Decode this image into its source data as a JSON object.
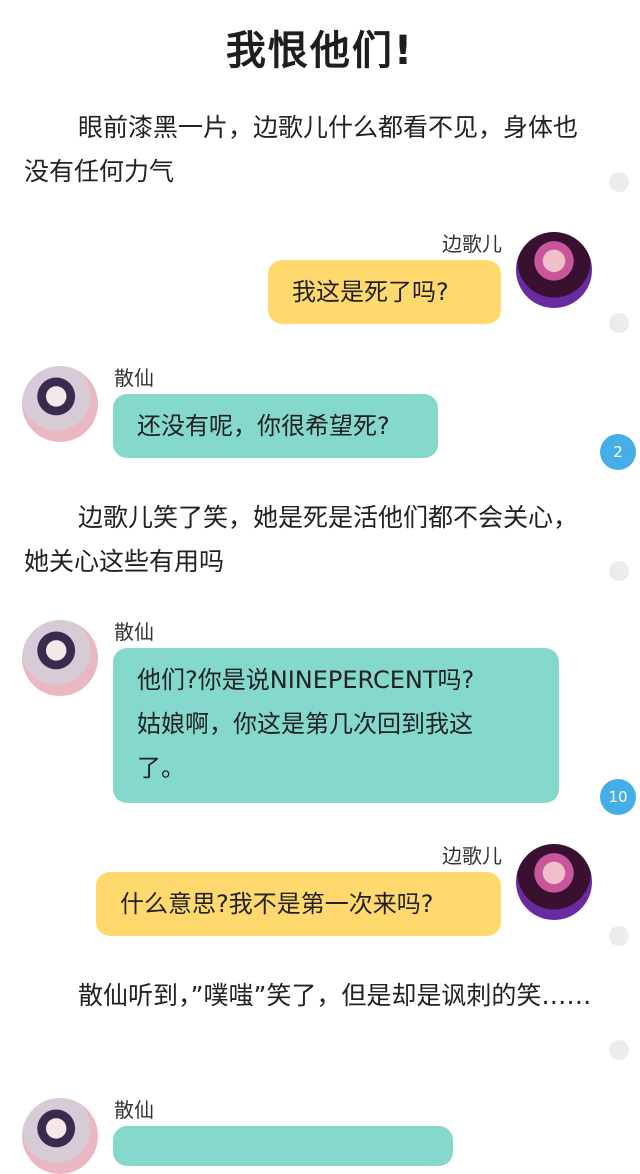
{
  "title": "我恨他们!",
  "blocks": {
    "n1": "眼前漆黑一片，边歌儿什么都看不见，身体也没有任何力气",
    "m1": {
      "speaker": "边歌儿",
      "text": "我这是死了吗?"
    },
    "m2": {
      "speaker": "散仙",
      "text": "还没有呢，你很希望死?",
      "badge": "2"
    },
    "n2": "边歌儿笑了笑，她是死是活他们都不会关心，她关心这些有用吗",
    "m3": {
      "speaker": "散仙",
      "text_lines": [
        "他们?你是说NINEPERCENT吗?",
        "姑娘啊，你这是第几次回到我这",
        "了。"
      ],
      "badge": "10"
    },
    "m4": {
      "speaker": "边歌儿",
      "text": "什么意思?我不是第一次来吗?"
    },
    "n3": "散仙听到，”噗嗤”笑了，但是却是讽刺的笑……",
    "m5": {
      "speaker": "散仙"
    }
  },
  "colors": {
    "yellow_bubble": "#ffd86e",
    "teal_bubble": "#84d8cc",
    "badge": "#45aee6"
  },
  "icons": {
    "right_avatar": "avatar-bian-geer",
    "left_avatar": "avatar-san-xian",
    "comment_dot": "comment-dot-icon"
  }
}
